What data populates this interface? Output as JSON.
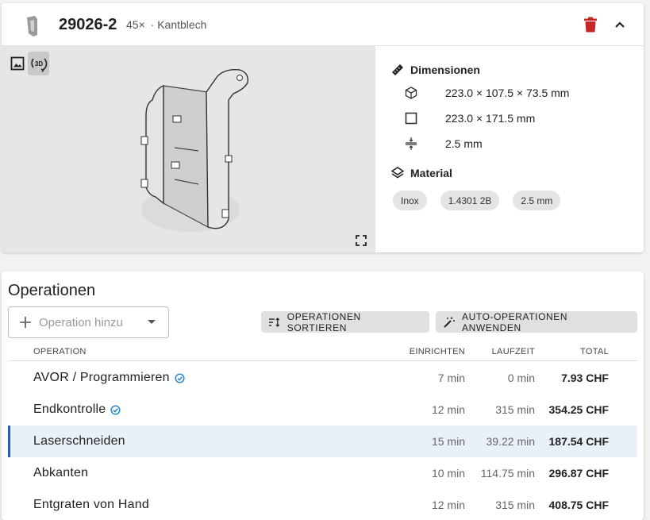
{
  "part": {
    "number": "29026-2",
    "quantity": "45×",
    "separator": "·",
    "type": "Kantblech"
  },
  "viewer": {
    "mode_2d_icon": "image-icon",
    "mode_3d_label": "3D",
    "active_mode": "3D"
  },
  "dimensions": {
    "heading": "Dimensionen",
    "bounding_box": "223.0 × 107.5 × 73.5 mm",
    "flat": "223.0 × 171.5 mm",
    "thickness": "2.5 mm"
  },
  "material": {
    "heading": "Material",
    "chips": [
      "Inox",
      "1.4301 2B",
      "2.5 mm"
    ]
  },
  "operations": {
    "title": "Operationen",
    "add_placeholder": "Operation hinzu",
    "sort_label": "OPERATIONEN SORTIEREN",
    "auto_label": "AUTO-OPERATIONEN ANWENDEN",
    "columns": [
      "OPERATION",
      "EINRICHTEN",
      "LAUFZEIT",
      "TOTAL"
    ],
    "rows": [
      {
        "name": "AVOR / Programmieren",
        "setup": "7 min",
        "runtime": "0 min",
        "total": "7.93 CHF",
        "verified": true,
        "selected": false
      },
      {
        "name": "Endkontrolle",
        "setup": "12 min",
        "runtime": "315 min",
        "total": "354.25 CHF",
        "verified": true,
        "selected": false
      },
      {
        "name": "Laserschneiden",
        "setup": "15 min",
        "runtime": "39.22 min",
        "total": "187.54 CHF",
        "verified": false,
        "selected": true
      },
      {
        "name": "Abkanten",
        "setup": "10 min",
        "runtime": "114.75 min",
        "total": "296.87 CHF",
        "verified": false,
        "selected": false
      },
      {
        "name": "Entgraten von Hand",
        "setup": "12 min",
        "runtime": "315 min",
        "total": "408.75 CHF",
        "verified": false,
        "selected": false
      }
    ]
  },
  "colors": {
    "accent": "#2c5fa0",
    "delete": "#c62828",
    "verified": "#2a86d1"
  }
}
